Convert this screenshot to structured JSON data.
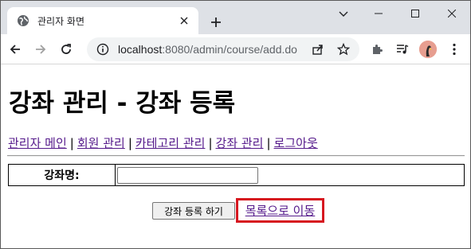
{
  "browser": {
    "tab": {
      "title": "관리자 화면",
      "favicon": "globe-icon"
    },
    "new_tab_icon": "plus-icon",
    "window_controls": [
      "tab-search-icon",
      "minimize-icon",
      "maximize-icon",
      "close-icon"
    ],
    "address": {
      "host": "localhost",
      "path": ":8080/admin/course/add.do"
    },
    "toolbar_icons": [
      "back-icon",
      "forward-icon",
      "reload-icon",
      "info-icon",
      "share-icon",
      "star-icon",
      "extensions-icon",
      "media-queue-icon",
      "avatar",
      "menu-icon"
    ]
  },
  "page": {
    "title": "강좌 관리 - 강좌 등록",
    "nav_links": [
      "관리자 메인",
      "회원 관리",
      "카테고리 관리",
      "강좌 관리",
      "로그아웃"
    ],
    "nav_separator": "|",
    "form": {
      "field_label": "강좌명:",
      "field_value": ""
    },
    "submit_label": "강좌 등록 하기",
    "list_link_label": "목록으로 이동",
    "highlight_color": "#d6161f",
    "link_color": "#551a8b"
  }
}
